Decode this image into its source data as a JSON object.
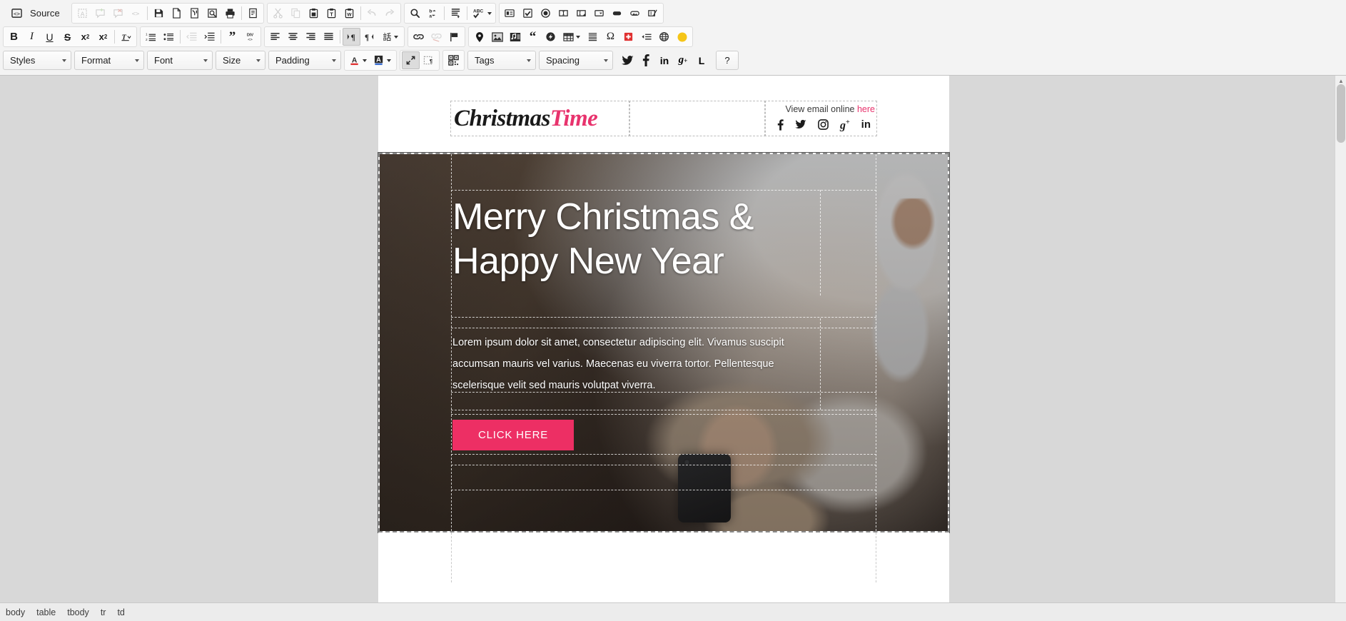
{
  "toolbar": {
    "source_label": "Source",
    "row1": [
      {
        "name": "source-button",
        "label": "Source",
        "icon": "source-icon",
        "disabled": false
      },
      {
        "name": "templates-button",
        "icon": "templates-icon",
        "disabled": true
      },
      {
        "name": "new-comment-button",
        "icon": "comment-add-icon",
        "disabled": true
      },
      {
        "name": "delete-comment-button",
        "icon": "comment-delete-icon",
        "disabled": true
      },
      {
        "name": "show-blocks-button",
        "icon": "code-tags-icon",
        "disabled": true
      },
      {
        "name": "save-button",
        "icon": "floppy-disk-icon",
        "disabled": false
      },
      {
        "name": "new-page-button",
        "icon": "new-page-icon",
        "disabled": false
      },
      {
        "name": "preview-mail-button",
        "icon": "preview-mail-icon",
        "disabled": false
      },
      {
        "name": "preview-button",
        "icon": "magnifier-page-icon",
        "disabled": false
      },
      {
        "name": "print-button",
        "icon": "printer-icon",
        "disabled": false
      },
      {
        "name": "document-properties-button",
        "icon": "document-props-icon",
        "disabled": false
      },
      {
        "name": "cut-button",
        "icon": "scissors-icon",
        "disabled": true
      },
      {
        "name": "copy-button",
        "icon": "copy-icon",
        "disabled": true
      },
      {
        "name": "paste-button",
        "icon": "clipboard-icon",
        "disabled": false
      },
      {
        "name": "paste-as-text-button",
        "icon": "clipboard-text-icon",
        "disabled": false
      },
      {
        "name": "paste-from-word-button",
        "icon": "clipboard-word-icon",
        "disabled": false
      },
      {
        "name": "undo-button",
        "icon": "undo-arrow-icon",
        "disabled": true
      },
      {
        "name": "redo-button",
        "icon": "redo-arrow-icon",
        "disabled": true
      },
      {
        "name": "find-button",
        "icon": "magnifier-icon",
        "disabled": false
      },
      {
        "name": "replace-button",
        "icon": "find-replace-icon",
        "disabled": false
      },
      {
        "name": "select-all-button",
        "icon": "select-all-icon",
        "disabled": false
      },
      {
        "name": "spell-check-button",
        "icon": "spellcheck-abc-icon",
        "disabled": false
      },
      {
        "name": "form-button",
        "icon": "form-icon",
        "disabled": false
      },
      {
        "name": "checkbox-button",
        "icon": "checkbox-icon",
        "disabled": false
      },
      {
        "name": "radio-button",
        "icon": "radio-button-icon",
        "disabled": false
      },
      {
        "name": "text-field-button",
        "icon": "text-field-icon",
        "disabled": false
      },
      {
        "name": "textarea-button",
        "icon": "textarea-icon",
        "disabled": false
      },
      {
        "name": "select-field-button",
        "icon": "select-field-icon",
        "disabled": false
      },
      {
        "name": "button-field-button",
        "icon": "button-icon",
        "disabled": false
      },
      {
        "name": "image-button-field-button",
        "icon": "image-button-icon",
        "disabled": false
      },
      {
        "name": "hidden-field-button",
        "icon": "hidden-field-icon",
        "disabled": false
      }
    ],
    "row2": [
      {
        "name": "bold-button",
        "icon": "bold-icon",
        "glyph": "B"
      },
      {
        "name": "italic-button",
        "icon": "italic-icon",
        "glyph": "I"
      },
      {
        "name": "underline-button",
        "icon": "underline-icon",
        "glyph": "U"
      },
      {
        "name": "strikethrough-button",
        "icon": "strikethrough-icon",
        "glyph": "S"
      },
      {
        "name": "subscript-button",
        "icon": "subscript-icon",
        "glyph": "x₂"
      },
      {
        "name": "superscript-button",
        "icon": "superscript-icon",
        "glyph": "x²"
      },
      {
        "name": "remove-format-button",
        "icon": "remove-format-icon",
        "glyph": "Tx"
      },
      {
        "name": "numbered-list-button",
        "icon": "numbered-list-icon"
      },
      {
        "name": "bulleted-list-button",
        "icon": "bulleted-list-icon"
      },
      {
        "name": "decrease-indent-button",
        "icon": "outdent-icon",
        "disabled": true
      },
      {
        "name": "increase-indent-button",
        "icon": "indent-icon"
      },
      {
        "name": "blockquote-button",
        "icon": "blockquote-icon"
      },
      {
        "name": "create-div-button",
        "icon": "div-container-icon"
      },
      {
        "name": "align-left-button",
        "icon": "align-left-icon"
      },
      {
        "name": "align-center-button",
        "icon": "align-center-icon"
      },
      {
        "name": "align-right-button",
        "icon": "align-right-icon"
      },
      {
        "name": "justify-button",
        "icon": "align-justify-icon"
      },
      {
        "name": "ltr-button",
        "icon": "text-direction-ltr-icon",
        "active": true
      },
      {
        "name": "rtl-button",
        "icon": "text-direction-rtl-icon"
      },
      {
        "name": "language-button",
        "icon": "language-icon"
      },
      {
        "name": "link-button",
        "icon": "link-icon"
      },
      {
        "name": "unlink-button",
        "icon": "unlink-icon",
        "disabled": true
      },
      {
        "name": "anchor-button",
        "icon": "flag-anchor-icon"
      },
      {
        "name": "map-marker-button",
        "icon": "map-marker-icon"
      },
      {
        "name": "image-button",
        "icon": "image-icon"
      },
      {
        "name": "media-button",
        "icon": "media-icon"
      },
      {
        "name": "quote-button",
        "icon": "quote-icon"
      },
      {
        "name": "flash-button",
        "icon": "flash-icon"
      },
      {
        "name": "table-button",
        "icon": "table-icon"
      },
      {
        "name": "horizontal-rule-button",
        "icon": "horizontal-rule-icon"
      },
      {
        "name": "special-char-button",
        "icon": "omega-icon"
      },
      {
        "name": "smiley-button",
        "icon": "red-cross-icon"
      },
      {
        "name": "page-break-button",
        "icon": "page-break-icon"
      },
      {
        "name": "iframe-button",
        "icon": "globe-icon"
      },
      {
        "name": "color-button",
        "icon": "yellow-circle-icon"
      }
    ],
    "row3": {
      "selects": [
        {
          "name": "styles-select",
          "label": "Styles"
        },
        {
          "name": "format-select",
          "label": "Format"
        },
        {
          "name": "font-select",
          "label": "Font"
        },
        {
          "name": "size-select",
          "label": "Size"
        },
        {
          "name": "padding-select",
          "label": "Padding"
        },
        {
          "name": "tags-select",
          "label": "Tags"
        },
        {
          "name": "spacing-select",
          "label": "Spacing"
        }
      ],
      "text_color_label": "A",
      "bg_color_label": "A",
      "buttons": [
        {
          "name": "maximize-button",
          "icon": "maximize-icon",
          "active": true
        },
        {
          "name": "show-blocks-button",
          "icon": "show-blocks-icon"
        },
        {
          "name": "qr-code-button",
          "icon": "qr-code-icon"
        }
      ],
      "social": [
        {
          "name": "twitter-share-button",
          "icon": "twitter-icon",
          "glyph": "t",
          "color": "#1b1b1b"
        },
        {
          "name": "facebook-share-button",
          "icon": "facebook-icon",
          "glyph": "f",
          "color": "#1b1b1b"
        },
        {
          "name": "linkedin-share-button",
          "icon": "linkedin-icon",
          "glyph": "in",
          "color": "#1b1b1b"
        },
        {
          "name": "googleplus-share-button",
          "icon": "google-plus-icon",
          "glyph": "g+",
          "color": "#1b1b1b"
        },
        {
          "name": "l-share-button",
          "icon": "letter-l-icon",
          "glyph": "L",
          "color": "#1b1b1b"
        }
      ],
      "help_label": "?"
    }
  },
  "email": {
    "logo": {
      "part1": "Christmas",
      "part2": "Time"
    },
    "view_online": {
      "text": "View email online",
      "link": "here"
    },
    "social_icons": [
      {
        "name": "facebook-icon",
        "glyph": "f"
      },
      {
        "name": "twitter-icon",
        "glyph": "t"
      },
      {
        "name": "instagram-icon",
        "glyph": "ig"
      },
      {
        "name": "google-plus-icon",
        "glyph": "g+"
      },
      {
        "name": "linkedin-icon",
        "glyph": "in"
      }
    ],
    "hero": {
      "title_line1": "Merry Christmas &",
      "title_line2": "Happy New Year",
      "body": "Lorem ipsum dolor sit amet, consectetur adipiscing elit. Vivamus suscipit accumsan mauris vel varius. Maecenas eu viverra tortor. Pellentesque scelerisque velit sed mauris volutpat viverra.",
      "cta_label": "CLICK HERE",
      "cta_color": "#ed2f64"
    }
  },
  "statusbar": {
    "path": [
      "body",
      "table",
      "tbody",
      "tr",
      "td"
    ]
  }
}
